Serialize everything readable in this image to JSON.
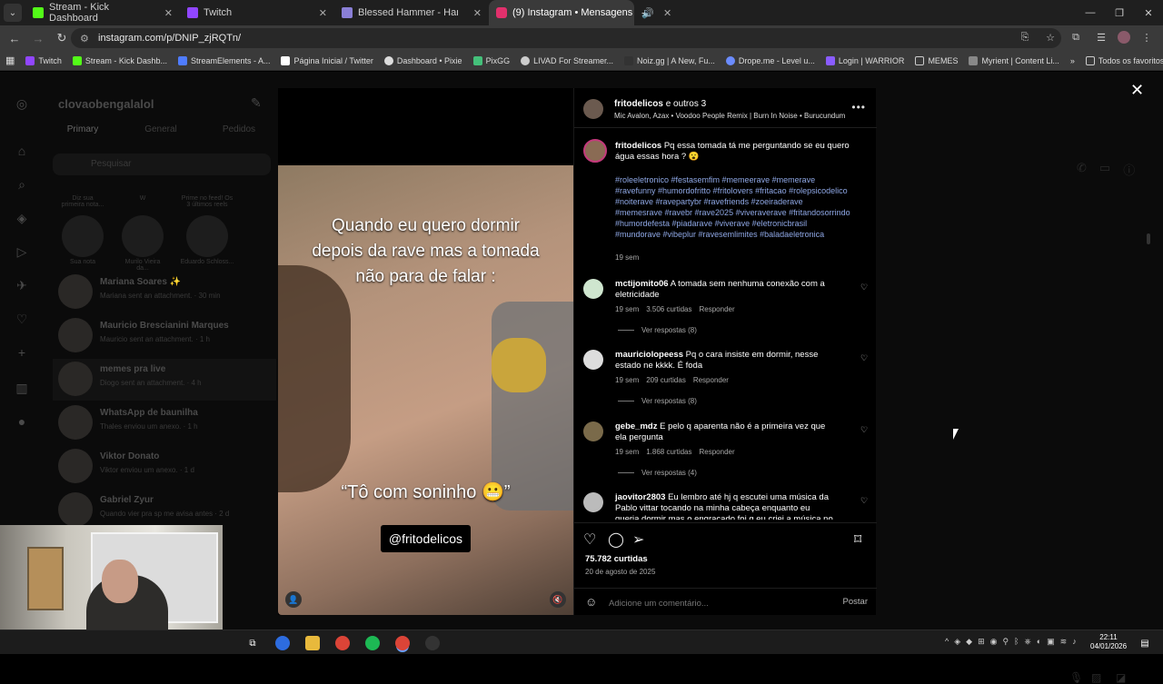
{
  "browser": {
    "tabs": [
      {
        "title": "Stream - Kick Dashboard",
        "color": "#53fc18"
      },
      {
        "title": "Twitch",
        "color": "#9146ff"
      },
      {
        "title": "Blessed Hammer - Hammerkun",
        "color": "#8a7fd6"
      },
      {
        "title": "(9) Instagram • Mensagens",
        "color": "#e1306c"
      }
    ],
    "url": "instagram.com/p/DNIP_zjRQTn/",
    "bookmarks": [
      {
        "label": "Twitch",
        "color": "#9146ff"
      },
      {
        "label": "Stream - Kick Dashb...",
        "color": "#53fc18"
      },
      {
        "label": "StreamElements - A...",
        "color": "#4f7cff"
      },
      {
        "label": "Página Inicial / Twitter",
        "color": "#ffffff"
      },
      {
        "label": "Dashboard • Pixie",
        "color": "#dddddd"
      },
      {
        "label": "PixGG",
        "color": "#44c07a"
      },
      {
        "label": "LIVAD For Streamer...",
        "color": "#cccccc"
      },
      {
        "label": "Noiz.gg | A New, Fu...",
        "color": "#333333"
      },
      {
        "label": "Drope.me - Level u...",
        "color": "#6b8cff"
      },
      {
        "label": "Login | WARRIOR",
        "color": "#8a5cff"
      },
      {
        "label": "MEMES",
        "color": "#cccccc"
      },
      {
        "label": "Myrient | Content Li...",
        "color": "#888888"
      }
    ],
    "all_bookmarks": "Todos os favoritos"
  },
  "dm": {
    "username": "clovaobengalalol",
    "tabs": [
      "Primary",
      "General",
      "Pedidos"
    ],
    "search_placeholder": "Pesquisar",
    "notes": [
      {
        "bubble": "Diz sua primeira nota...",
        "name": "Sua nota"
      },
      {
        "bubble": "W",
        "name": "Murilo Vieira da..."
      },
      {
        "bubble": "Prime no feed! Os 3 últimos reels",
        "name": "Eduardo Schloss..."
      }
    ],
    "conversations": [
      {
        "name": "Mariana Soares ✨",
        "preview": "Mariana sent an attachment. · 30 min"
      },
      {
        "name": "Mauricio Brescianini Marques",
        "preview": "Mauricio sent an attachment. · 1 h"
      },
      {
        "name": "memes pra live",
        "preview": "Diogo sent an attachment. · 4 h"
      },
      {
        "name": "WhatsApp de baunilha",
        "preview": "Thales enviou um anexo. · 1 h"
      },
      {
        "name": "Viktor Donato",
        "preview": "Viktor enviou um anexo. · 1 d"
      },
      {
        "name": "Gabriel Zyur",
        "preview": "Quando vier pra sp me avisa antes · 2 d"
      }
    ]
  },
  "post": {
    "caption_top": "Quando eu quero dormir depois da rave mas a tomada não para de falar :",
    "caption_bottom": "“Tô com soninho 😬”",
    "watermark": "@fritodelicos",
    "header": {
      "author": "fritodelicos",
      "others": "e outros 3",
      "audio": "Mic Avalon, Azax • Voodoo People Remix | Burn In Noise • Burucundum"
    },
    "description": {
      "author": "fritodelicos",
      "text": "Pq essa tomada tá me perguntando se eu quero água essas hora ? 😮",
      "hashtags": "#roleeletronico #festasemfim #memeerave #memerave #ravefunny #humordofritto #fritolovers #fritacao #rolepsicodelico #noiterave #ravepartybr #ravefriends #zoeiraderave #memesrave #ravebr #rave2025 #viveraverave #fritandosorrindo #humordefesta #piadarave #viverave #eletronicbrasil #mundorave #vibeplur #ravesemlimites #baladaeletronica",
      "time": "19 sem"
    },
    "comments": [
      {
        "user": "mctijomito06",
        "text": "A tomada sem nenhuma conexão com a eletricidade",
        "time": "19 sem",
        "likes": "3.506 curtidas",
        "reply": "Responder",
        "replies": "Ver respostas (8)"
      },
      {
        "user": "mauriciolopeess",
        "text": "Pq o cara insiste em dormir, nesse estado ne kkkk. É foda",
        "time": "19 sem",
        "likes": "209 curtidas",
        "reply": "Responder",
        "replies": "Ver respostas (8)"
      },
      {
        "user": "gebe_mdz",
        "text": "E pelo q aparenta não é a primeira vez que ela pergunta",
        "time": "19 sem",
        "likes": "1.868 curtidas",
        "reply": "Responder",
        "replies": "Ver respostas (4)"
      },
      {
        "user": "jaovitor2803",
        "text": "Eu lembro até hj q escutei uma música da Pablo vittar tocando na minha cabeça enquanto eu queria dormir mas o engraçado foi q eu criei a música no até então ela não",
        "time": "",
        "likes": "",
        "reply": "",
        "replies": ""
      }
    ],
    "likes": "75.782 curtidas",
    "date": "20 de agosto de 2025",
    "add_comment_placeholder": "Adicione um comentário...",
    "post_button": "Postar"
  },
  "taskbar": {
    "time": "22:11",
    "date": "04/01/2026"
  }
}
